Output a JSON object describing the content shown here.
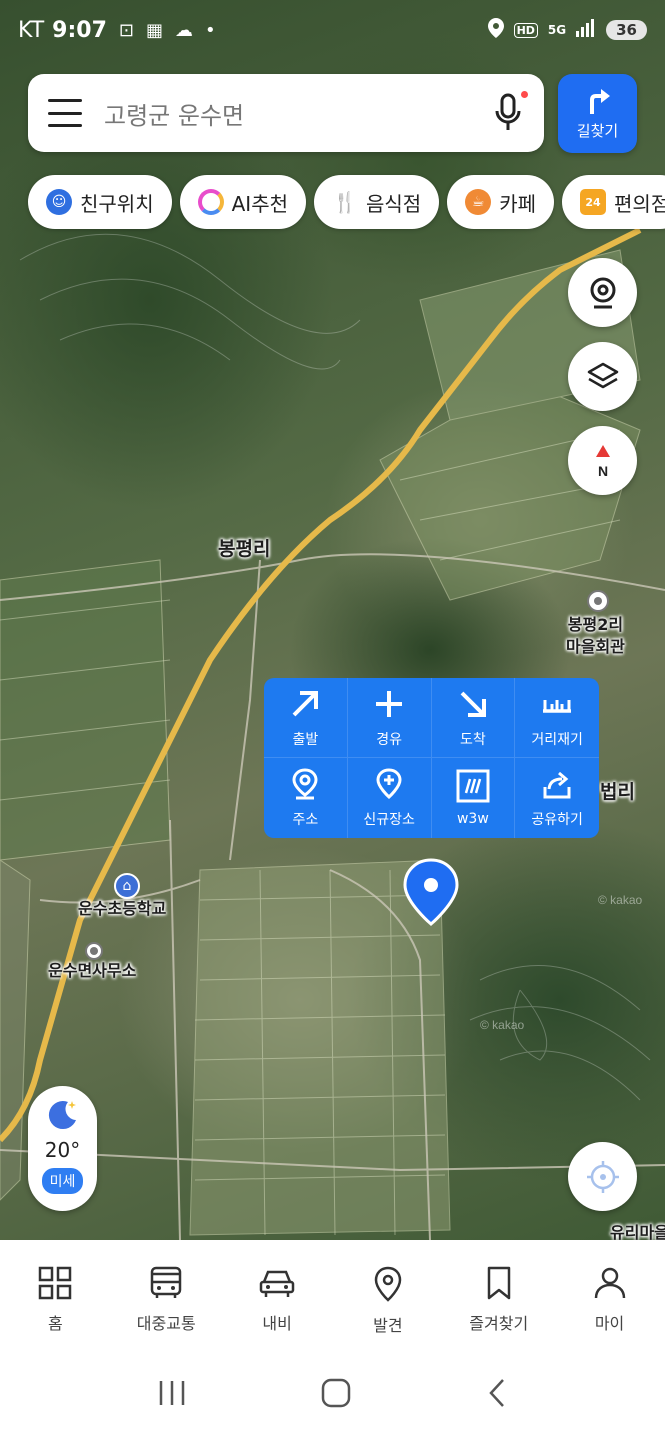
{
  "status_bar": {
    "carrier": "KT",
    "time": "9:07",
    "network": "5G",
    "hd": "HD",
    "battery": "36"
  },
  "search": {
    "placeholder": "고령군 운수면"
  },
  "route_button": {
    "label": "길찾기"
  },
  "chips": [
    {
      "label": "친구위치",
      "icon": "friend-location-icon",
      "color": "#2f6fe0"
    },
    {
      "label": "AI추천",
      "icon": "ai-ring-icon",
      "color": "#e84dcb"
    },
    {
      "label": "음식점",
      "icon": "restaurant-icon",
      "color": "#f08a35"
    },
    {
      "label": "카페",
      "icon": "cafe-icon",
      "color": "#f08a35"
    },
    {
      "label": "편의점",
      "icon": "convenience-store-icon",
      "color": "#f5a623",
      "badge": "24"
    }
  ],
  "map": {
    "labels": {
      "bongpyeong": "봉평리",
      "hall": "봉평2리\n마을회관",
      "beopri": "법리",
      "school": "운수초등학교",
      "office": "운수면사무소",
      "yuri": "유리마을",
      "kakao1": "© kakao",
      "kakao2": "© kakao"
    }
  },
  "context_menu": {
    "items": [
      {
        "label": "출발",
        "icon": "start-arrow-icon"
      },
      {
        "label": "경유",
        "icon": "waypoint-plus-icon"
      },
      {
        "label": "도착",
        "icon": "arrive-arrow-icon"
      },
      {
        "label": "거리재기",
        "icon": "ruler-icon"
      },
      {
        "label": "주소",
        "icon": "address-pin-icon"
      },
      {
        "label": "신규장소",
        "icon": "new-place-pin-icon"
      },
      {
        "label": "w3w",
        "icon": "w3w-icon"
      },
      {
        "label": "공유하기",
        "icon": "share-icon"
      }
    ]
  },
  "weather": {
    "temperature": "20°",
    "dust_label": "미세"
  },
  "bottom_nav": [
    {
      "label": "홈",
      "icon": "home-grid-icon"
    },
    {
      "label": "대중교통",
      "icon": "bus-icon"
    },
    {
      "label": "내비",
      "icon": "car-icon"
    },
    {
      "label": "발견",
      "icon": "location-pin-icon"
    },
    {
      "label": "즐겨찾기",
      "icon": "bookmark-icon"
    },
    {
      "label": "마이",
      "icon": "person-icon"
    }
  ]
}
